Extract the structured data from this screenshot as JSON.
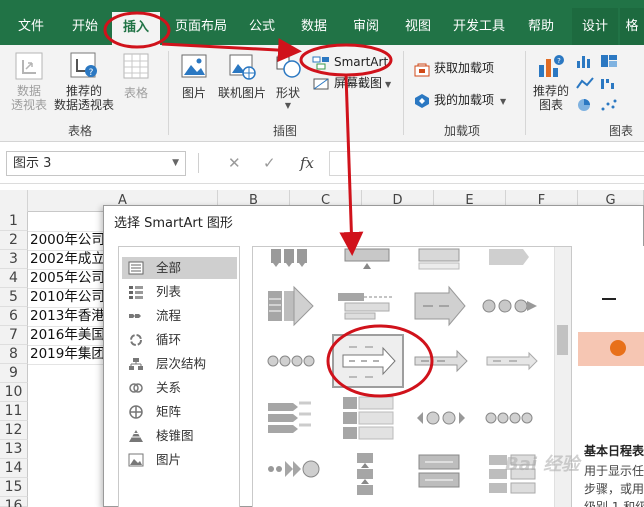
{
  "tabs": [
    {
      "label": "文件"
    },
    {
      "label": "开始"
    },
    {
      "label": "插入"
    },
    {
      "label": "页面布局"
    },
    {
      "label": "公式"
    },
    {
      "label": "数据"
    },
    {
      "label": "审阅"
    },
    {
      "label": "视图"
    },
    {
      "label": "开发工具"
    },
    {
      "label": "帮助"
    },
    {
      "label": "设计"
    },
    {
      "label": "格"
    }
  ],
  "ribbon": {
    "tables_group": {
      "label": "表格",
      "pivot_table": "数据\n透视表",
      "recommended_pivot": "推荐的\n数据透视表",
      "table": "表格"
    },
    "illustrations_group": {
      "label": "插图",
      "picture": "图片",
      "online_picture": "联机图片",
      "shapes": "形状",
      "smartart": "SmartArt",
      "screenshot": "屏幕截图"
    },
    "addins_group": {
      "label": "加载项",
      "get_addins": "获取加载项",
      "my_addins": "我的加载项"
    },
    "charts_group": {
      "label": "图表",
      "recommended_charts": "推荐的\n图表"
    }
  },
  "formula_bar": {
    "name_box": "图示 3",
    "cancel_symbol": "✕",
    "enter_symbol": "✓",
    "fx_symbol": "fx"
  },
  "grid": {
    "columns": [
      "A",
      "B",
      "C",
      "D",
      "E",
      "F",
      "G"
    ],
    "rows": [
      "1",
      "2",
      "3",
      "4",
      "5",
      "6",
      "7",
      "8",
      "9",
      "10",
      "11",
      "12",
      "13",
      "14",
      "15",
      "16"
    ],
    "cells": [
      "",
      "2000年公司",
      "2002年成立",
      "2005年公司",
      "2010年公司",
      "2013年香港",
      "2016年美国",
      "2019年集团"
    ]
  },
  "dialog": {
    "title": "选择 SmartArt 图形",
    "categories": [
      {
        "label": "全部",
        "icon": "all-icon"
      },
      {
        "label": "列表",
        "icon": "list-icon"
      },
      {
        "label": "流程",
        "icon": "process-icon"
      },
      {
        "label": "循环",
        "icon": "cycle-icon"
      },
      {
        "label": "层次结构",
        "icon": "hierarchy-icon"
      },
      {
        "label": "关系",
        "icon": "relationship-icon"
      },
      {
        "label": "矩阵",
        "icon": "matrix-icon"
      },
      {
        "label": "棱锥图",
        "icon": "pyramid-icon"
      },
      {
        "label": "图片",
        "icon": "picture-icon"
      }
    ],
    "preview_title": "基本日程表",
    "preview_lines": [
      "用于显示任",
      "步骤，或用",
      "级别 1 和级"
    ]
  },
  "watermark": "Bai 经验",
  "colors": {
    "excel_green": "#217346",
    "annotation_red": "#d0121b",
    "preview_dot": "#e8701a",
    "preview_band": "#f6c6b3"
  }
}
